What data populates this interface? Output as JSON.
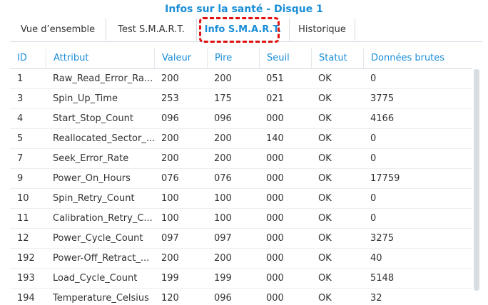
{
  "title": "Infos sur la santé - Disque 1",
  "tabs": [
    {
      "label": "Vue d’ensemble"
    },
    {
      "label": "Test S.M.A.R.T."
    },
    {
      "label": "Info S.M.A.R.T."
    },
    {
      "label": "Historique"
    }
  ],
  "active_tab": "Info S.M.A.R.T.",
  "highlight_color": "#e01010",
  "accent_color": "#1a8ed8",
  "table": {
    "headers": [
      "ID",
      "Attribut",
      "Valeur",
      "Pire",
      "Seuil",
      "Statut",
      "Données brutes"
    ],
    "rows": [
      [
        "1",
        "Raw_Read_Error_Ra...",
        "200",
        "200",
        "051",
        "OK",
        "0"
      ],
      [
        "3",
        "Spin_Up_Time",
        "253",
        "175",
        "021",
        "OK",
        "3775"
      ],
      [
        "4",
        "Start_Stop_Count",
        "096",
        "096",
        "000",
        "OK",
        "4166"
      ],
      [
        "5",
        "Reallocated_Sector_...",
        "200",
        "200",
        "140",
        "OK",
        "0"
      ],
      [
        "7",
        "Seek_Error_Rate",
        "200",
        "200",
        "000",
        "OK",
        "0"
      ],
      [
        "9",
        "Power_On_Hours",
        "076",
        "076",
        "000",
        "OK",
        "17759"
      ],
      [
        "10",
        "Spin_Retry_Count",
        "100",
        "100",
        "000",
        "OK",
        "0"
      ],
      [
        "11",
        "Calibration_Retry_C...",
        "100",
        "100",
        "000",
        "OK",
        "0"
      ],
      [
        "12",
        "Power_Cycle_Count",
        "097",
        "097",
        "000",
        "OK",
        "3275"
      ],
      [
        "192",
        "Power-Off_Retract_...",
        "200",
        "200",
        "000",
        "OK",
        "40"
      ],
      [
        "193",
        "Load_Cycle_Count",
        "199",
        "199",
        "000",
        "OK",
        "5148"
      ],
      [
        "194",
        "Temperature_Celsius",
        "120",
        "096",
        "000",
        "OK",
        "32"
      ]
    ]
  }
}
